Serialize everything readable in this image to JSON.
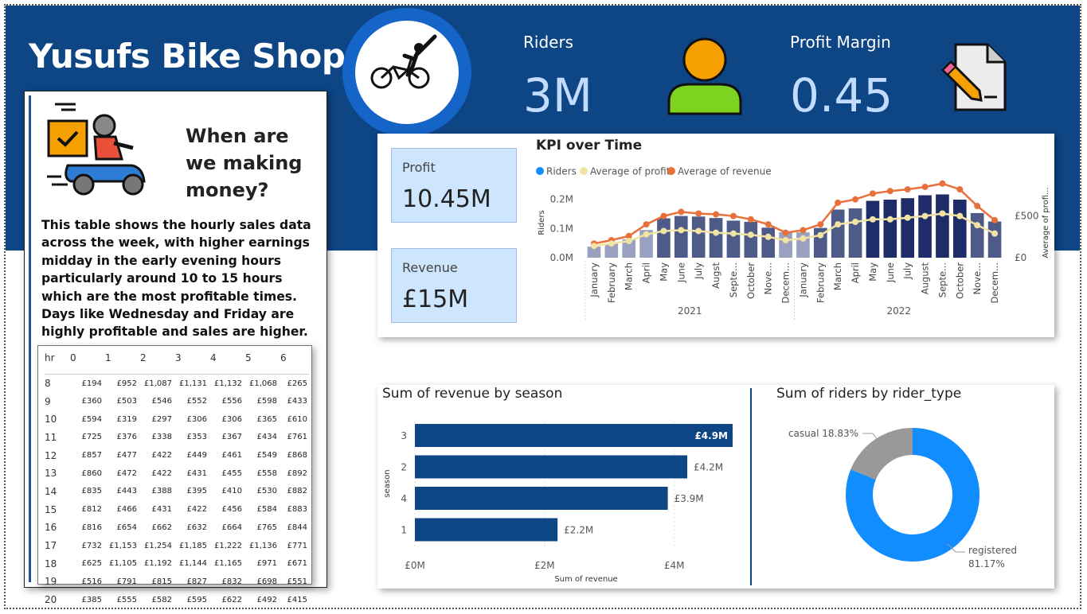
{
  "header": {
    "title": "Yusufs Bike Shop",
    "riders_label": "Riders",
    "riders_value": "3M",
    "margin_label": "Profit Margin",
    "margin_value": "0.45"
  },
  "panel": {
    "heading": "When are we making money?",
    "description": "This table shows the hourly sales data across the week, with higher earnings midday in the early evening hours particularly around 10 to 15 hours which are the most profitable times. Days like Wednesday and Friday are highly profitable and sales are higher."
  },
  "matrix": {
    "corner": "hr",
    "columns": [
      "0",
      "1",
      "2",
      "3",
      "4",
      "5",
      "6"
    ],
    "rows": [
      {
        "hr": "8",
        "v": [
          "£194",
          "£952",
          "£1,087",
          "£1,131",
          "£1,132",
          "£1,068",
          "£265"
        ]
      },
      {
        "hr": "9",
        "v": [
          "£360",
          "£503",
          "£546",
          "£552",
          "£556",
          "£598",
          "£433"
        ]
      },
      {
        "hr": "10",
        "v": [
          "£594",
          "£319",
          "£297",
          "£306",
          "£306",
          "£365",
          "£610"
        ]
      },
      {
        "hr": "11",
        "v": [
          "£725",
          "£376",
          "£338",
          "£353",
          "£367",
          "£434",
          "£761"
        ]
      },
      {
        "hr": "12",
        "v": [
          "£857",
          "£477",
          "£422",
          "£449",
          "£461",
          "£549",
          "£868"
        ]
      },
      {
        "hr": "13",
        "v": [
          "£860",
          "£472",
          "£422",
          "£431",
          "£455",
          "£558",
          "£892"
        ]
      },
      {
        "hr": "14",
        "v": [
          "£835",
          "£443",
          "£388",
          "£395",
          "£410",
          "£530",
          "£882"
        ]
      },
      {
        "hr": "15",
        "v": [
          "£812",
          "£466",
          "£431",
          "£422",
          "£456",
          "£584",
          "£883"
        ]
      },
      {
        "hr": "16",
        "v": [
          "£816",
          "£654",
          "£662",
          "£632",
          "£664",
          "£765",
          "£844"
        ]
      },
      {
        "hr": "17",
        "v": [
          "£732",
          "£1,153",
          "£1,254",
          "£1,185",
          "£1,222",
          "£1,136",
          "£771"
        ]
      },
      {
        "hr": "18",
        "v": [
          "£625",
          "£1,105",
          "£1,192",
          "£1,144",
          "£1,165",
          "£971",
          "£671"
        ]
      },
      {
        "hr": "19",
        "v": [
          "£516",
          "£791",
          "£815",
          "£827",
          "£832",
          "£698",
          "£551"
        ]
      },
      {
        "hr": "20",
        "v": [
          "£385",
          "£555",
          "£582",
          "£595",
          "£622",
          "£492",
          "£415"
        ]
      }
    ]
  },
  "cards": {
    "profit_label": "Profit",
    "profit_value": "10.45M",
    "revenue_label": "Revenue",
    "revenue_value": "£15M"
  },
  "colors": {
    "banner": "#0d4585",
    "bar_dark": "#1e2c6a",
    "bar_mid": "#4e5a87",
    "bar_light": "#9aa0bf",
    "revenue_line": "#e8703a",
    "profit_line": "#f0e3a4",
    "riders_legend": "#118dff",
    "hbar": "#0d4585",
    "donut_registered": "#118dff",
    "donut_casual": "#999999"
  },
  "chart_data": [
    {
      "type": "bar",
      "title": "KPI over Time",
      "legend": [
        "Riders",
        "Average of profit",
        "Average of revenue"
      ],
      "legend_position": "top-left",
      "ylabel": "Riders",
      "y2label": "Average of profi...",
      "yticks": [
        "0.0M",
        "0.1M",
        "0.2M"
      ],
      "y2ticks": [
        "£0",
        "£500"
      ],
      "ylim": [
        0,
        0.24
      ],
      "y2lim": [
        0,
        840
      ],
      "years": [
        "2021",
        "2022"
      ],
      "categories": [
        "January",
        "February",
        "March",
        "April",
        "May",
        "June",
        "July",
        "Augst",
        "Septe...",
        "October",
        "Nove...",
        "Decem...",
        "January",
        "February",
        "March",
        "April",
        "May",
        "June",
        "July",
        "August",
        "Septe...",
        "October",
        "Nove...",
        "Decem..."
      ],
      "series": [
        {
          "name": "Riders",
          "values": [
            0.038,
            0.048,
            0.063,
            0.095,
            0.135,
            0.143,
            0.141,
            0.136,
            0.127,
            0.123,
            0.103,
            0.087,
            0.087,
            0.102,
            0.165,
            0.169,
            0.195,
            0.199,
            0.204,
            0.214,
            0.217,
            0.199,
            0.153,
            0.124
          ]
        },
        {
          "name": "Average of profit",
          "values": [
            140,
            170,
            200,
            280,
            320,
            330,
            320,
            300,
            290,
            275,
            250,
            210,
            230,
            270,
            400,
            430,
            460,
            460,
            480,
            500,
            530,
            500,
            390,
            290
          ]
        },
        {
          "name": "Average of revenue",
          "values": [
            170,
            210,
            260,
            400,
            500,
            550,
            530,
            520,
            500,
            460,
            400,
            300,
            330,
            400,
            660,
            700,
            770,
            800,
            820,
            850,
            890,
            820,
            620,
            450
          ]
        }
      ]
    },
    {
      "type": "bar",
      "title": "Sum of revenue by season",
      "xlabel": "Sum of revenue",
      "ylabel": "season",
      "xticks": [
        "£0M",
        "£2M",
        "£4M"
      ],
      "xlim": [
        0,
        4.9
      ],
      "categories": [
        "3",
        "2",
        "4",
        "1"
      ],
      "values": [
        4.9,
        4.2,
        3.9,
        2.2
      ],
      "labels": [
        "£4.9M",
        "£4.2M",
        "£3.9M",
        "£2.2M"
      ]
    },
    {
      "type": "pie",
      "title": "Sum of riders by rider_type",
      "categories": [
        "casual",
        "registered"
      ],
      "values": [
        18.83,
        81.17
      ],
      "labels": [
        "casual 18.83%",
        "registered",
        "81.17%"
      ]
    }
  ]
}
